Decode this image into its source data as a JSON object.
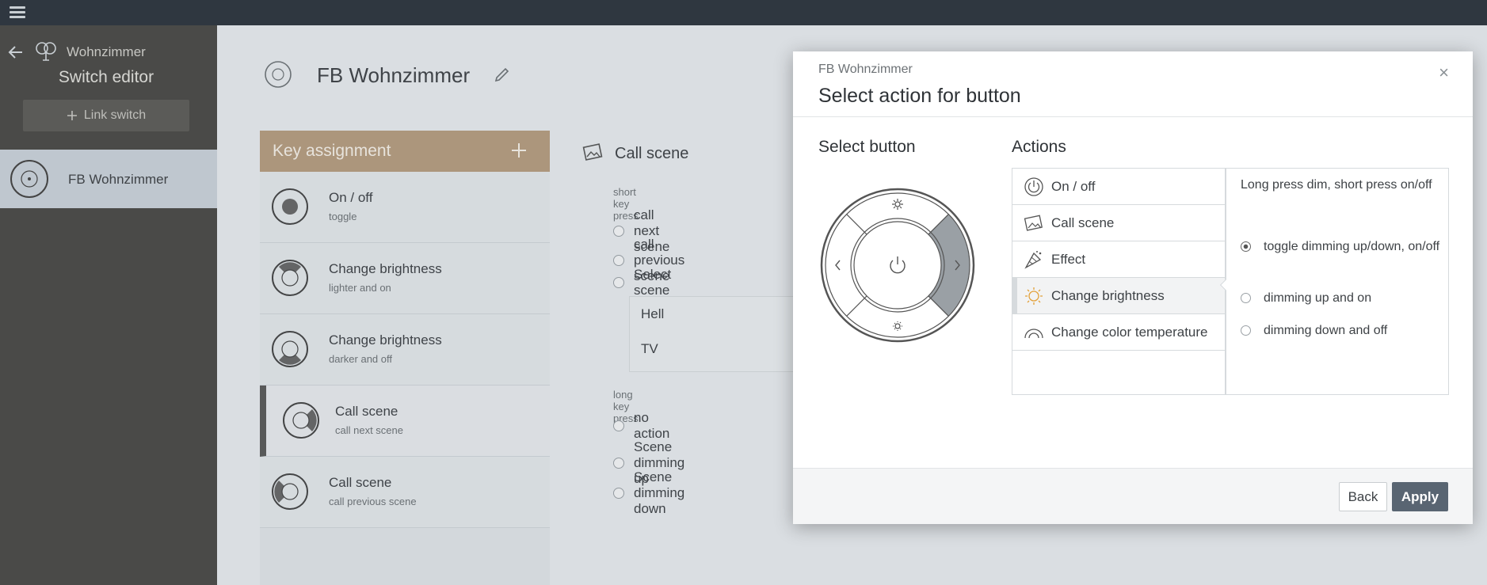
{
  "sidebar": {
    "room": "Wohnzimmer",
    "title": "Switch editor",
    "link_button": "Link switch",
    "device_item": "FB Wohnzimmer"
  },
  "device": {
    "title": "FB Wohnzimmer"
  },
  "key_assignment": {
    "header": "Key assignment",
    "rows": [
      {
        "title": "On / off",
        "subtitle": "toggle"
      },
      {
        "title": "Change brightness",
        "subtitle": "lighter and on"
      },
      {
        "title": "Change brightness",
        "subtitle": "darker and off"
      },
      {
        "title": "Call scene",
        "subtitle": "call next scene"
      },
      {
        "title": "Call scene",
        "subtitle": "call previous scene"
      }
    ]
  },
  "call_scene": {
    "title": "Call scene",
    "short_label": "short key press",
    "short_options": [
      "call next scene",
      "call previous scene",
      "Select scene"
    ],
    "scenes": [
      "Hell",
      "TV"
    ],
    "long_label": "long key press",
    "long_options": [
      "no action",
      "Scene dimming up",
      "Scene dimming down"
    ]
  },
  "modal": {
    "subtitle": "FB Wohnzimmer",
    "title": "Select action for button",
    "close": "×",
    "select_button_heading": "Select button",
    "actions_heading": "Actions",
    "actions": [
      "On / off",
      "Call scene",
      "Effect",
      "Change brightness",
      "Change color temperature"
    ],
    "selected_action": "Change brightness",
    "option_desc": "Long press dim, short press on/off",
    "options": [
      "toggle dimming up/down, on/off",
      "dimming up and on",
      "dimming down and off"
    ],
    "selected_option": "toggle dimming up/down, on/off",
    "back": "Back",
    "apply": "Apply"
  },
  "colors": {
    "accent": "#b59c7e",
    "apply": "#596572",
    "topbar": "#2f3740",
    "sidebar": "#4a4a48"
  }
}
